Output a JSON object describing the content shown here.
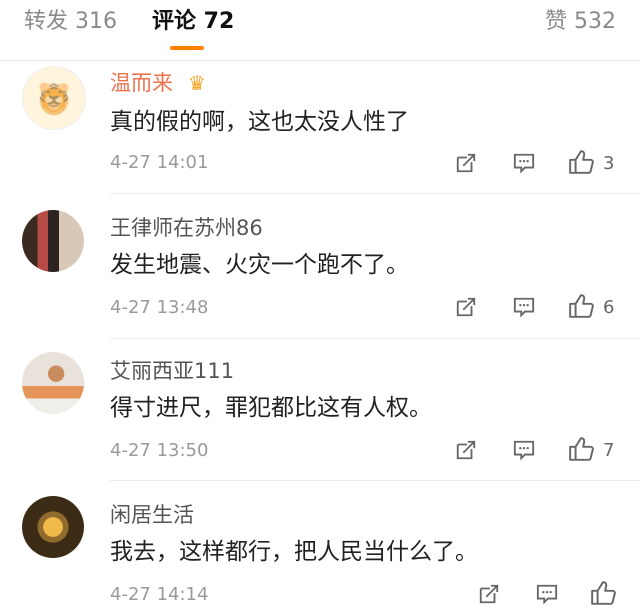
{
  "tabs": {
    "repost_label": "转发 316",
    "comment_label": "评论 72",
    "like_label": "赞 532"
  },
  "comments": [
    {
      "name": "温而来",
      "text": "真的假的啊，这也太没人性了",
      "time": "4-27 14:01",
      "likes": "3"
    },
    {
      "name": "王律师在苏州86",
      "text": "发生地震、火灾一个跑不了。",
      "time": "4-27 13:48",
      "likes": "6"
    },
    {
      "name": "艾丽西亚111",
      "text": "得寸进尺，罪犯都比这有人权。",
      "time": "4-27 13:50",
      "likes": "7"
    },
    {
      "name": "闲居生活",
      "text": "我去，这样都行，把人民当什么了。",
      "time": "4-27 14:14",
      "likes": ""
    }
  ],
  "icons": {
    "share": "share-icon",
    "comment": "comment-icon",
    "like": "thumbs-up-icon",
    "vip": "crown-icon"
  },
  "colors": {
    "accent": "#ff8200",
    "vip_name": "#eb7350"
  }
}
